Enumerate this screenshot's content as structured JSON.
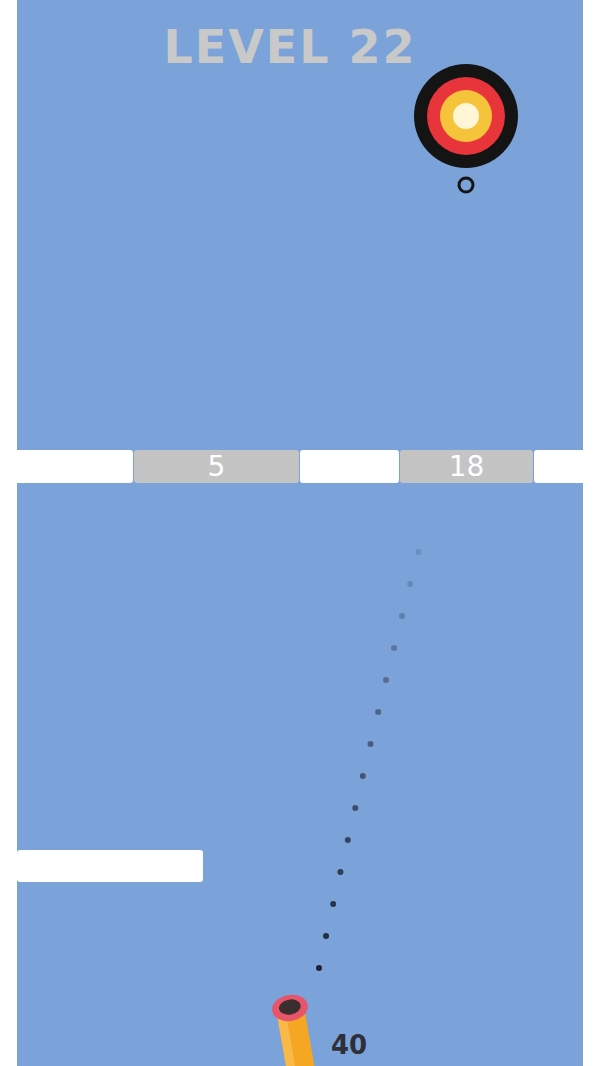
{
  "level": {
    "title": "LEVEL 22"
  },
  "bar": {
    "segments": [
      {
        "kind": "gap"
      },
      {
        "kind": "block",
        "hits": "5"
      },
      {
        "kind": "gap"
      },
      {
        "kind": "block",
        "hits": "18"
      },
      {
        "kind": "gap"
      }
    ]
  },
  "cannon": {
    "balls": "40"
  }
}
